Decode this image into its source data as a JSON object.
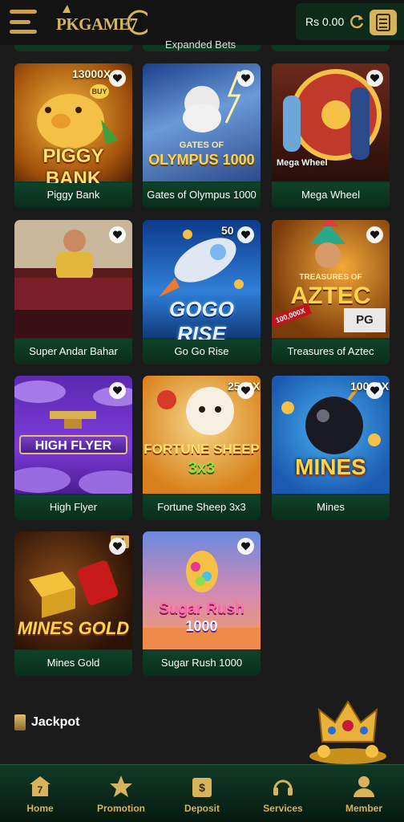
{
  "header": {
    "logo": "PKGAME7",
    "balance": "Rs 0.00"
  },
  "partial_row": {
    "label": "Expanded Bets"
  },
  "games": [
    {
      "name": "Piggy Bank",
      "art_title": "PIGGY BANK",
      "corner": "13000X",
      "badge": "BUY"
    },
    {
      "name": "Gates of Olympus 1000",
      "art_title": "OLYMPUS 1000",
      "art_top": "GATES OF"
    },
    {
      "name": "Mega Wheel",
      "art_title": "Mega Wheel"
    },
    {
      "name": "Super Andar Bahar",
      "art_title": ""
    },
    {
      "name": "Go Go Rise",
      "art_title": "GOGO RISE",
      "corner": "50"
    },
    {
      "name": "Treasures of Aztec",
      "art_title": "AZTEC",
      "art_top": "TREASURES OF",
      "corner_badge": "100,000X",
      "provider": "PG"
    },
    {
      "name": "High Flyer",
      "art_title": "HIGH FLYER"
    },
    {
      "name": "Fortune Sheep 3x3",
      "art_title": "FORTUNE SHEEP",
      "art_sub": "3x3",
      "corner": "2500X"
    },
    {
      "name": "Mines",
      "art_title": "MINES",
      "corner": "10000X"
    },
    {
      "name": "Mines Gold",
      "art_title": "MINES GOLD",
      "corner": "11"
    },
    {
      "name": "Sugar Rush 1000",
      "art_title": "Sugar Rush",
      "art_sub": "1000"
    }
  ],
  "jackpot": {
    "label": "Jackpot"
  },
  "bottom_nav": [
    {
      "label": "Home",
      "icon": "home-icon"
    },
    {
      "label": "Promotion",
      "icon": "star-icon"
    },
    {
      "label": "Deposit",
      "icon": "deposit-icon"
    },
    {
      "label": "Services",
      "icon": "headset-icon"
    },
    {
      "label": "Member",
      "icon": "user-icon"
    }
  ],
  "colors": {
    "accent_gold": "#d7b45b",
    "card_green": "#0e3a25",
    "background": "#1b1b1b"
  }
}
